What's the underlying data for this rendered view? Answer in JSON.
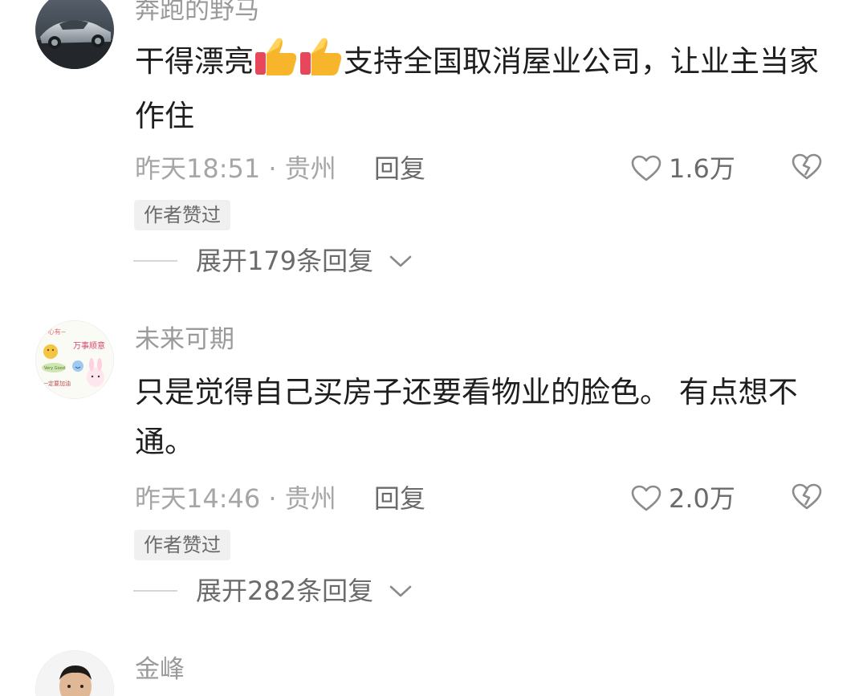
{
  "comments": [
    {
      "username": "奔跑的野马",
      "text_before": "干得漂亮",
      "text_after": "支持全国取消屋业公司，让业主当家作住",
      "time_location": "昨天18:51 · 贵州",
      "reply_label": "回复",
      "likes": "1.6万",
      "badge": "作者赞过",
      "expand_label": "展开179条回复",
      "avatar_icon": "sports-car-photo"
    },
    {
      "username": "未来可期",
      "text": "只是觉得自己买房子还要看物业的脸色。 有点想不通。",
      "time_location": "昨天14:46 · 贵州",
      "reply_label": "回复",
      "likes": "2.0万",
      "badge": "作者赞过",
      "expand_label": "展开282条回复",
      "avatar_icon": "cartoon-sticker-avatar",
      "avatar_text": [
        "万事顺意",
        "Very Good",
        "一定要加油"
      ]
    },
    {
      "username": "金峰",
      "avatar_icon": "man-portrait-photo"
    }
  ],
  "colors": {
    "username": "#9a9a9a",
    "body": "#1e1e1e",
    "meta": "#a6a6a6",
    "action": "#6b6b6b",
    "badge_bg": "#f0f0f0"
  }
}
